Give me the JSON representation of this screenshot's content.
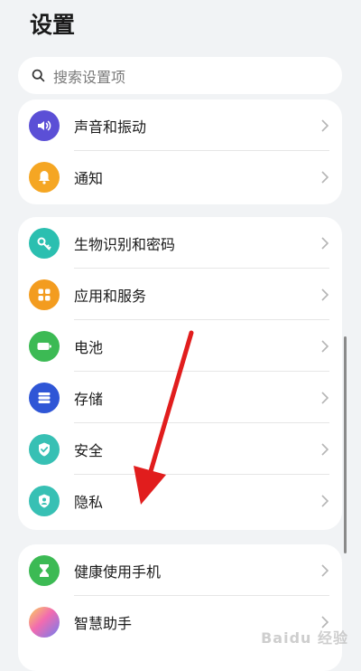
{
  "title": "设置",
  "search": {
    "placeholder": "搜索设置项"
  },
  "cards": [
    {
      "items": [
        {
          "id": "sound",
          "label": "声音和振动",
          "icon": "speaker-icon",
          "color": "#5b4fd6"
        },
        {
          "id": "notifications",
          "label": "通知",
          "icon": "bell-icon",
          "color": "#f5a623"
        }
      ]
    },
    {
      "items": [
        {
          "id": "biometrics",
          "label": "生物识别和密码",
          "icon": "key-icon",
          "color": "#2bbfb0"
        },
        {
          "id": "apps",
          "label": "应用和服务",
          "icon": "apps-grid-icon",
          "color": "#f39c1f"
        },
        {
          "id": "battery",
          "label": "电池",
          "icon": "battery-icon",
          "color": "#3cba54"
        },
        {
          "id": "storage",
          "label": "存储",
          "icon": "storage-icon",
          "color": "#2f56d6"
        },
        {
          "id": "security",
          "label": "安全",
          "icon": "shield-check-icon",
          "color": "#37c0b4"
        },
        {
          "id": "privacy",
          "label": "隐私",
          "icon": "privacy-user-icon",
          "color": "#37c0b4"
        }
      ]
    },
    {
      "items": [
        {
          "id": "digital-balance",
          "label": "健康使用手机",
          "icon": "hourglass-icon",
          "color": "#3cba54"
        },
        {
          "id": "assistant",
          "label": "智慧助手",
          "icon": "assistant-orb-icon",
          "color": "#f26bb0"
        }
      ]
    }
  ],
  "watermark": "Baidu 经验"
}
